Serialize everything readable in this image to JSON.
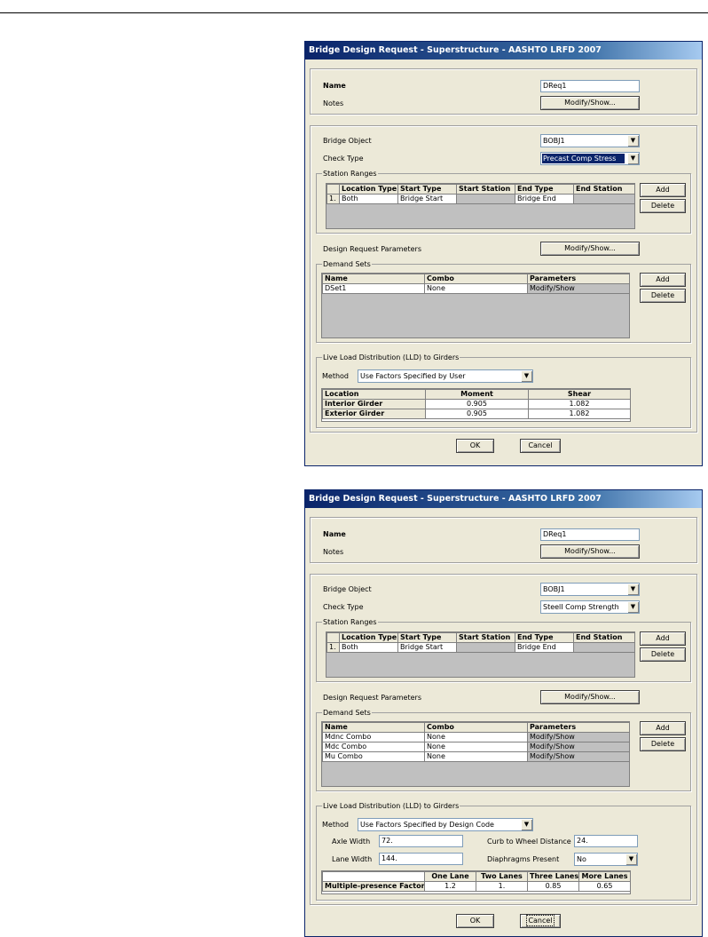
{
  "dialogs": [
    {
      "title": "Bridge Design Request - Superstructure - AASHTO LRFD 2007",
      "name_label": "Name",
      "name_value": "DReq1",
      "notes_label": "Notes",
      "notes_button": "Modify/Show...",
      "bridge_object_label": "Bridge Object",
      "bridge_object_value": "BOBJ1",
      "check_type_label": "Check Type",
      "check_type_value": "Precast Comp Stress",
      "station_ranges_title": "Station Ranges",
      "station_headers": [
        "Location Type",
        "Start Type",
        "Start Station",
        "End Type",
        "End Station"
      ],
      "station_rows": [
        {
          "index": "1.",
          "location_type": "Both",
          "start_type": "Bridge Start",
          "start_station": "",
          "end_type": "Bridge End",
          "end_station": ""
        }
      ],
      "add_label": "Add",
      "delete_label": "Delete",
      "design_params_label": "Design Request Parameters",
      "design_params_button": "Modify/Show...",
      "demand_sets_title": "Demand Sets",
      "demand_headers": [
        "Name",
        "Combo",
        "Parameters"
      ],
      "demand_rows": [
        {
          "name": "DSet1",
          "combo": "None",
          "params": "Modify/Show"
        }
      ],
      "lld_title": "Live Load Distribution (LLD) to Girders",
      "method_label": "Method",
      "method_value": "Use Factors Specified by User",
      "factor_headers": [
        "Location",
        "Moment",
        "Shear"
      ],
      "factor_rows": [
        {
          "location": "Interior Girder",
          "moment": "0.905",
          "shear": "1.082"
        },
        {
          "location": "Exterior Girder",
          "moment": "0.905",
          "shear": "1.082"
        }
      ],
      "ok_label": "OK",
      "cancel_label": "Cancel"
    },
    {
      "title": "Bridge Design Request - Superstructure - AASHTO LRFD 2007",
      "name_label": "Name",
      "name_value": "DReq1",
      "notes_label": "Notes",
      "notes_button": "Modify/Show...",
      "bridge_object_label": "Bridge Object",
      "bridge_object_value": "BOBJ1",
      "check_type_label": "Check Type",
      "check_type_value": "SteelI Comp Strength",
      "station_ranges_title": "Station Ranges",
      "station_headers": [
        "Location Type",
        "Start Type",
        "Start Station",
        "End Type",
        "End Station"
      ],
      "station_rows": [
        {
          "index": "1.",
          "location_type": "Both",
          "start_type": "Bridge Start",
          "start_station": "",
          "end_type": "Bridge End",
          "end_station": ""
        }
      ],
      "add_label": "Add",
      "delete_label": "Delete",
      "design_params_label": "Design Request Parameters",
      "design_params_button": "Modify/Show...",
      "demand_sets_title": "Demand Sets",
      "demand_headers": [
        "Name",
        "Combo",
        "Parameters"
      ],
      "demand_rows": [
        {
          "name": "Mdnc Combo",
          "combo": "None",
          "params": "Modify/Show"
        },
        {
          "name": "Mdc Combo",
          "combo": "None",
          "params": "Modify/Show"
        },
        {
          "name": "Mu Combo",
          "combo": "None",
          "params": "Modify/Show"
        }
      ],
      "lld_title": "Live Load Distribution (LLD) to Girders",
      "method_label": "Method",
      "method_value": "Use Factors Specified by Design Code",
      "axle_width_label": "Axle Width",
      "axle_width_value": "72.",
      "lane_width_label": "Lane Width",
      "lane_width_value": "144.",
      "curb_label": "Curb to Wheel Distance",
      "curb_value": "24.",
      "diaphragms_label": "Diaphragms Present",
      "diaphragms_value": "No",
      "mp_headers": [
        "One Lane",
        "Two Lanes",
        "Three Lanes",
        "More Lanes"
      ],
      "mp_row_label": "Multiple-presence Factor",
      "mp_values": [
        "1.2",
        "1.",
        "0.85",
        "0.65"
      ],
      "ok_label": "OK",
      "cancel_label": "Cancel"
    }
  ]
}
